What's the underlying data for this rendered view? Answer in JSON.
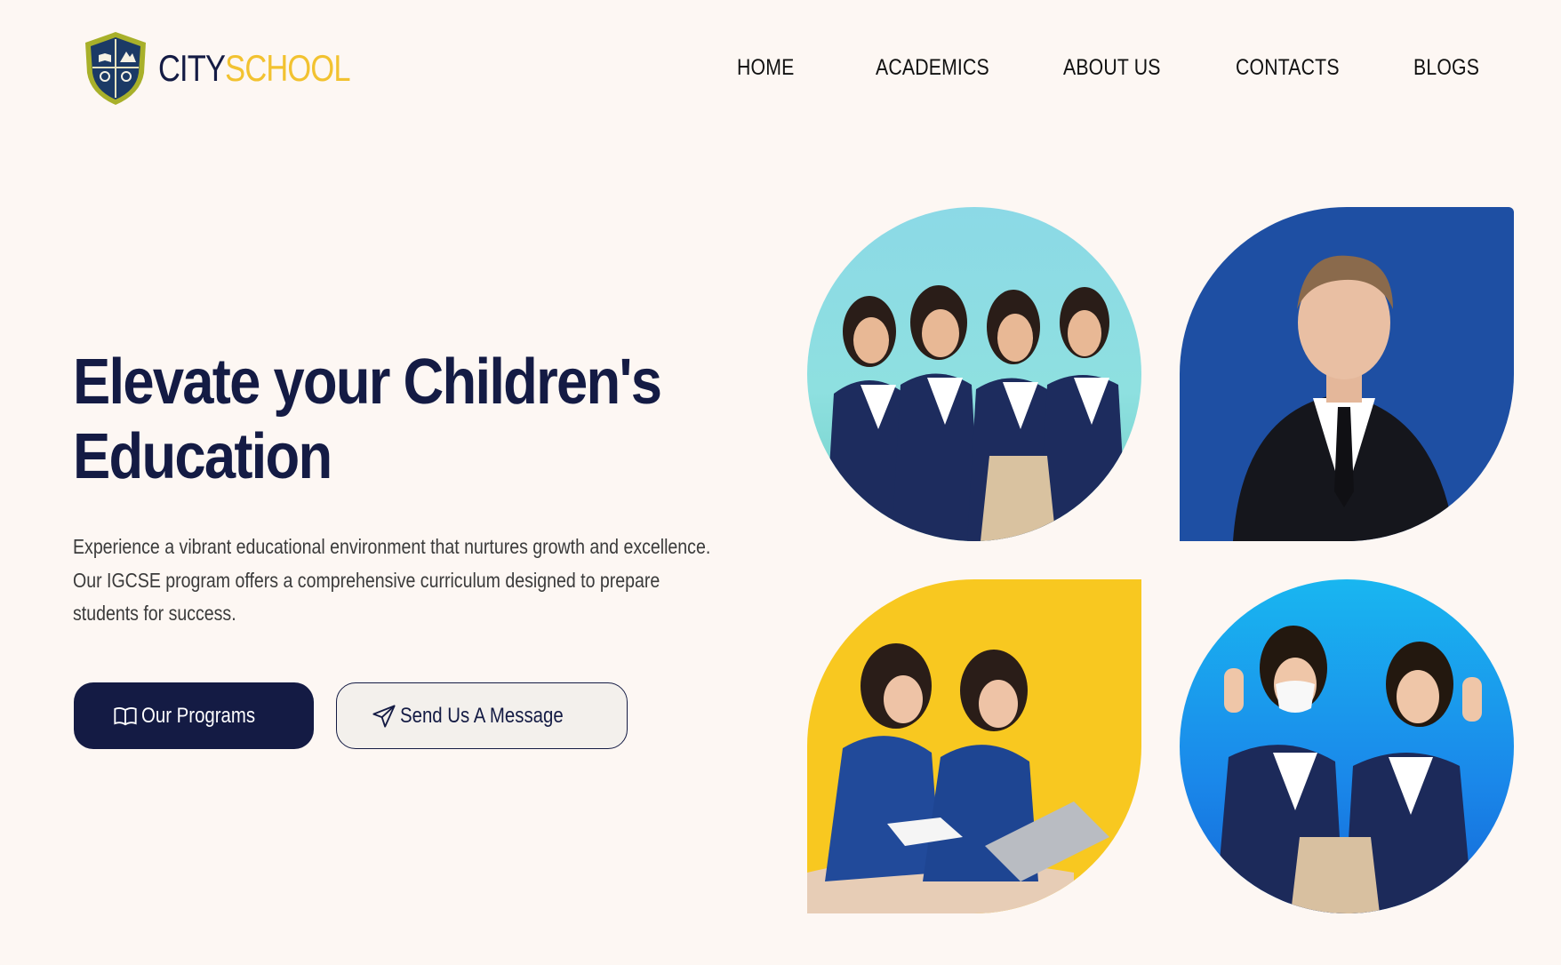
{
  "brand": {
    "part1": "CITY",
    "part2": "SCHOOL"
  },
  "nav": {
    "items": [
      {
        "label": "HOME"
      },
      {
        "label": "ACADEMICS"
      },
      {
        "label": "ABOUT US"
      },
      {
        "label": "CONTACTS"
      },
      {
        "label": "BLOGS"
      }
    ]
  },
  "hero": {
    "title_line1": "Elevate your Children's",
    "title_line2": "Education",
    "subtitle_line1": "Experience a vibrant educational environment that nurtures growth and excellence.",
    "subtitle_line2": "Our IGCSE program offers a comprehensive curriculum designed to prepare",
    "subtitle_line3": "students for success.",
    "primary_button": "Our Programs",
    "primary_icon": "book-open-icon",
    "secondary_button": "Send Us A Message",
    "secondary_icon": "send-icon"
  },
  "colors": {
    "navy": "#141b44",
    "yellow": "#f2c230",
    "background": "#fdf7f3",
    "blue_tile": "#1e4fa3"
  }
}
